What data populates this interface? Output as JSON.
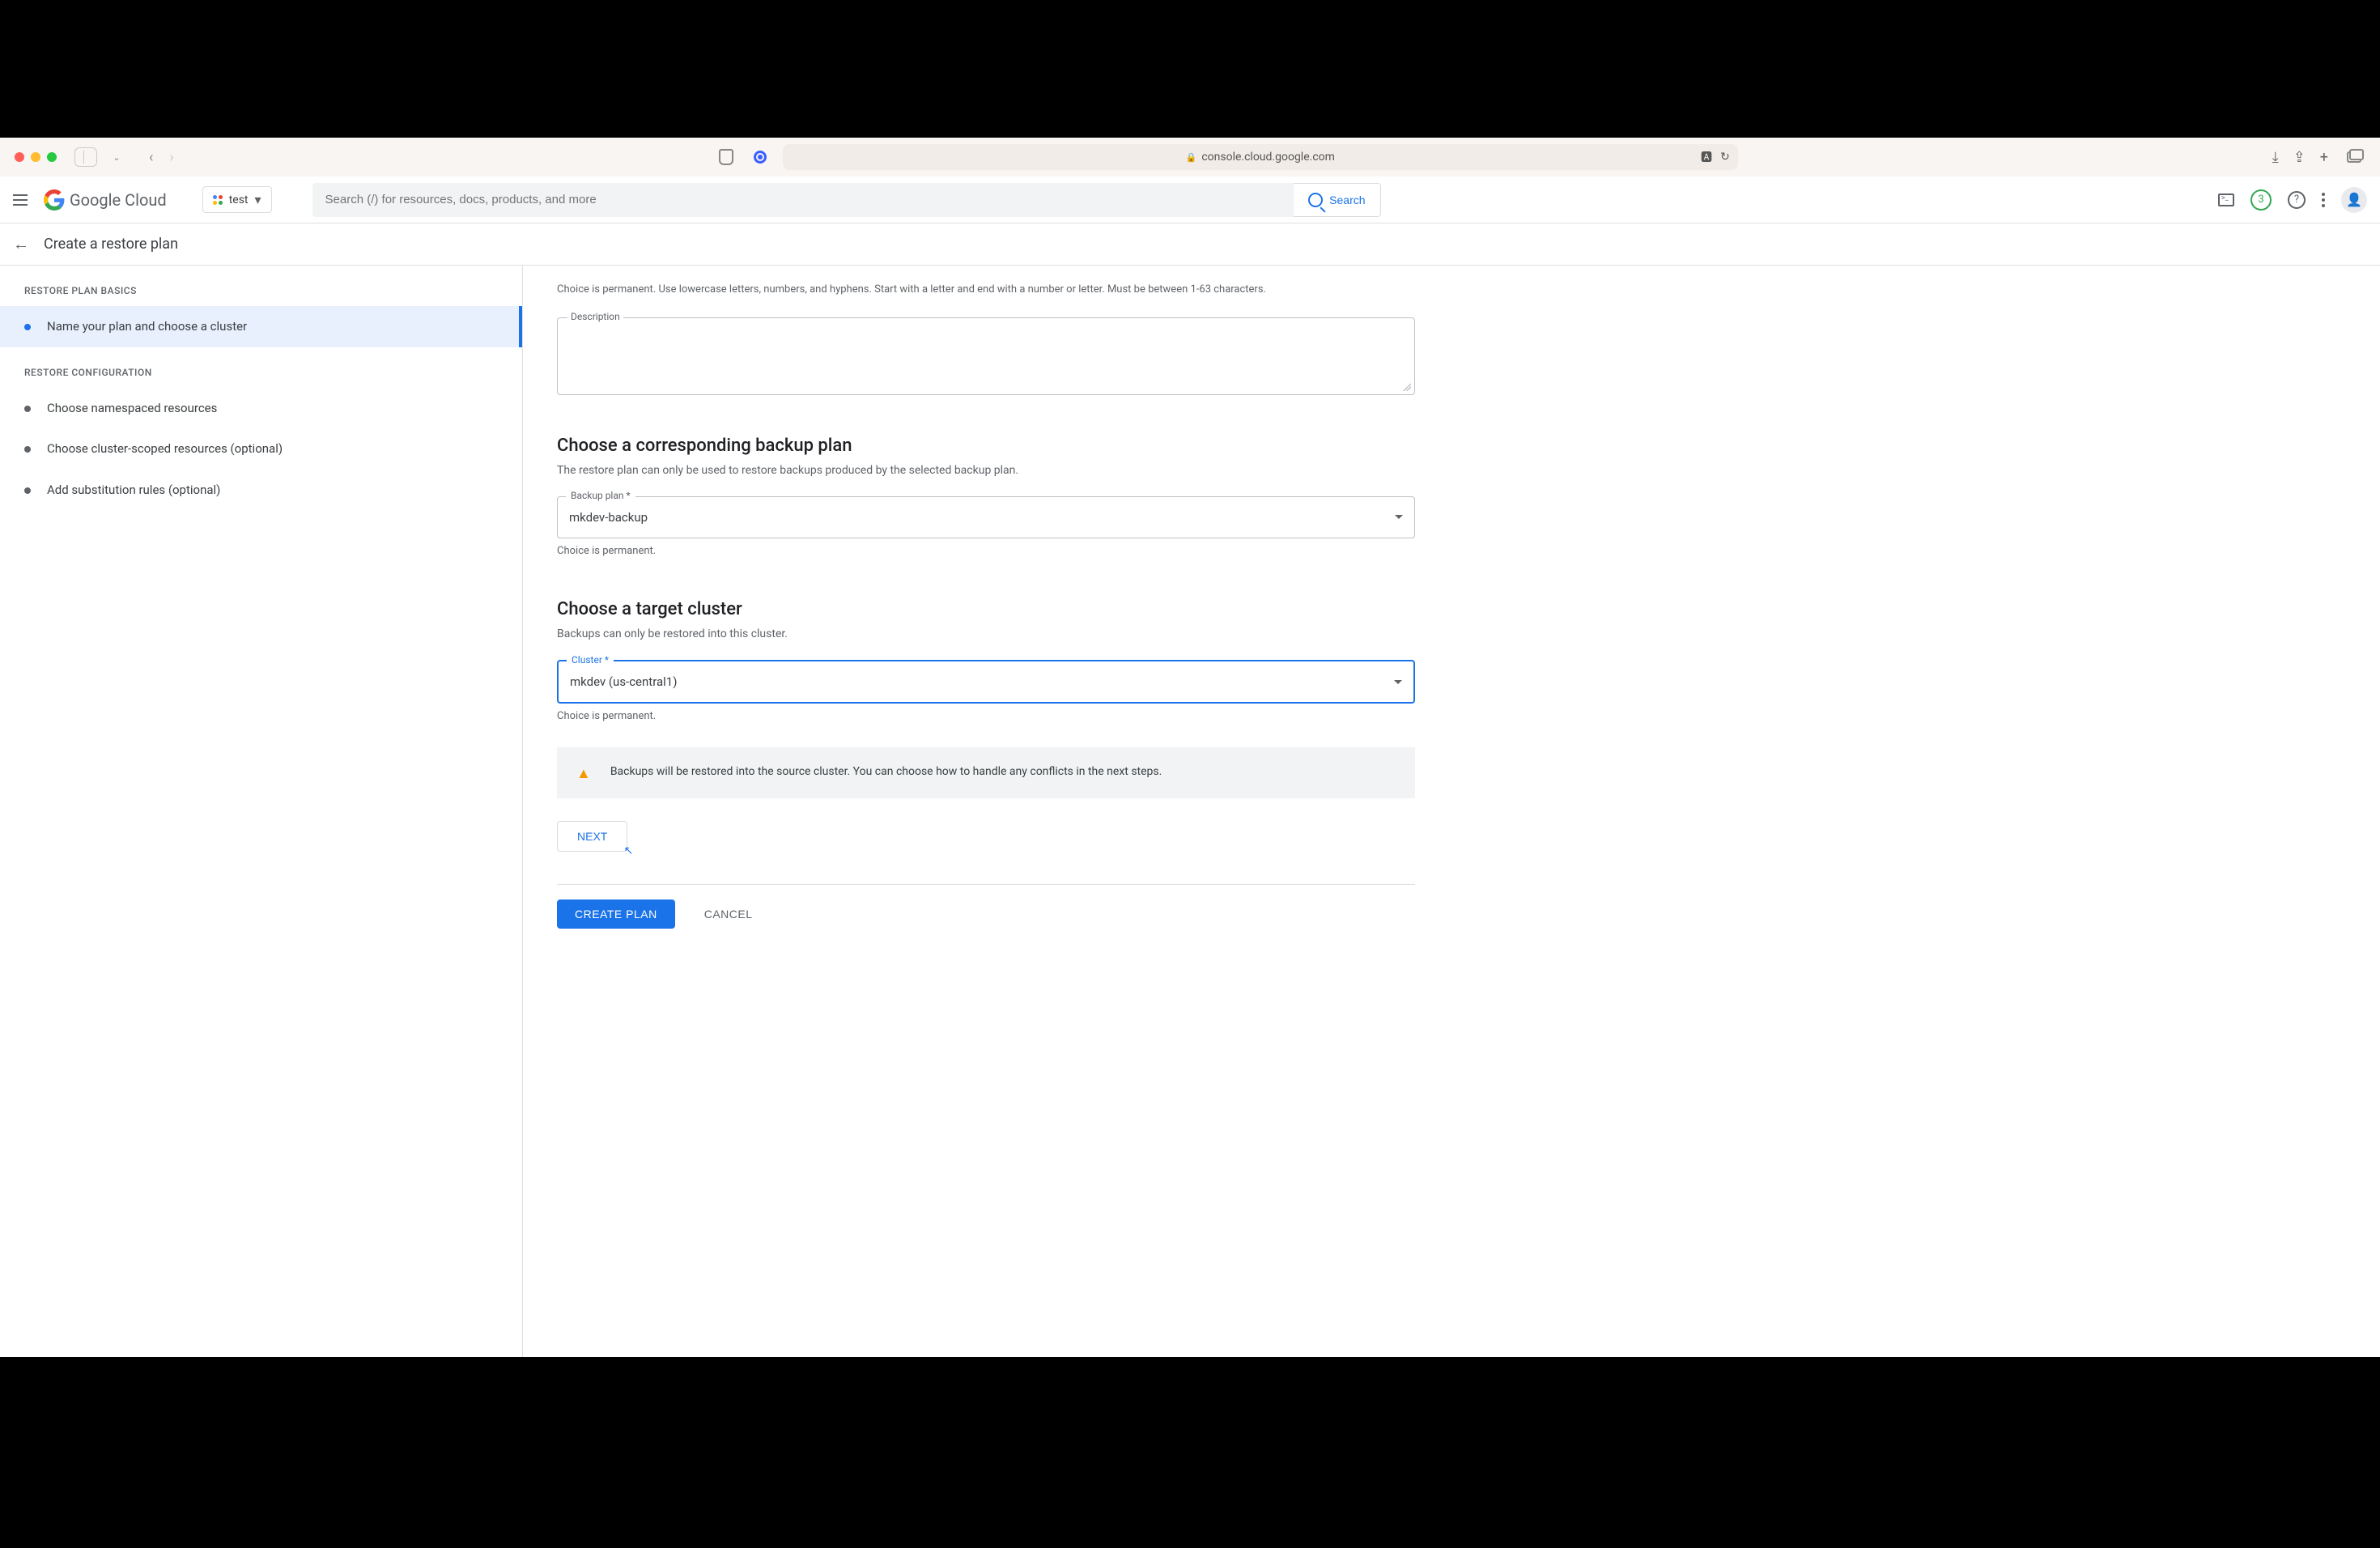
{
  "browser": {
    "url": "console.cloud.google.com"
  },
  "header": {
    "logo_text": "Google Cloud",
    "project_name": "test",
    "search_placeholder": "Search (/) for resources, docs, products, and more",
    "search_button": "Search",
    "notification_count": "3"
  },
  "subheader": {
    "title": "Create a restore plan"
  },
  "sidebar": {
    "section1_title": "RESTORE PLAN BASICS",
    "section2_title": "RESTORE CONFIGURATION",
    "steps": {
      "name_cluster": "Name your plan and choose a cluster",
      "namespaced": "Choose namespaced resources",
      "cluster_scoped": "Choose cluster-scoped resources (optional)",
      "substitution": "Add substitution rules (optional)"
    }
  },
  "form": {
    "name_helper": "Choice is permanent. Use lowercase letters, numbers, and hyphens. Start with a letter and end with a number or letter. Must be between 1-63 characters.",
    "description_label": "Description",
    "backup_section": {
      "heading": "Choose a corresponding backup plan",
      "desc": "The restore plan can only be used to restore backups produced by the selected backup plan.",
      "label": "Backup plan *",
      "value": "mkdev-backup",
      "helper": "Choice is permanent."
    },
    "cluster_section": {
      "heading": "Choose a target cluster",
      "desc": "Backups can only be restored into this cluster.",
      "label": "Cluster *",
      "value": "mkdev (us-central1)",
      "helper": "Choice is permanent."
    },
    "warning": "Backups will be restored into the source cluster. You can choose how to handle any conflicts in the next steps.",
    "next_button": "NEXT",
    "create_button": "CREATE PLAN",
    "cancel_button": "CANCEL"
  }
}
